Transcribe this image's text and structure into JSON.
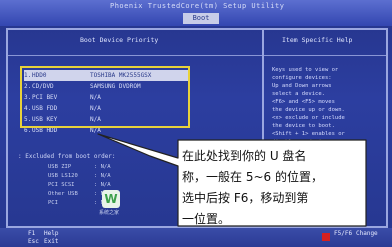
{
  "bios": {
    "title": "Phoenix TrustedCore(tm) Setup Utility",
    "active_tab": "Boot"
  },
  "left_panel": {
    "title": "Boot Device Priority",
    "boot_devices": [
      {
        "num": "1.",
        "device": "HDD0",
        "info": "TOSHIBA MK2555GSX",
        "selected": true
      },
      {
        "num": "2.",
        "device": "CD/DVD",
        "info": "SAMSUNG DVDROM",
        "selected": false
      },
      {
        "num": "3.",
        "device": "PCI BEV",
        "info": "N/A",
        "selected": false
      },
      {
        "num": "4.",
        "device": "USB FDD",
        "info": "N/A",
        "selected": false
      },
      {
        "num": "5.",
        "device": "USB KEY",
        "info": "N/A",
        "selected": false
      },
      {
        "num": "6.",
        "device": "USB HDD",
        "info": "N/A",
        "selected": false
      }
    ],
    "excluded_title": ":  Excluded from boot order:",
    "excluded_devices": [
      {
        "device": "USB ZIP",
        "info": ": N/A"
      },
      {
        "device": "USB LS120",
        "info": ": N/A"
      },
      {
        "device": "PCI SCSI",
        "info": ": N/A"
      },
      {
        "device": "Other USB",
        "info": ": N/A"
      },
      {
        "device": "PCI",
        "info": ": N/A"
      }
    ]
  },
  "right_panel": {
    "title": "Item Specific Help",
    "help_lines": [
      "Keys used to view or",
      "configure devices:",
      "Up and Down arrows",
      "select a device.",
      "<F6> and <F5> moves",
      "the device up or down.",
      "<x> exclude or include",
      "the device to boot.",
      "<Shift + 1> enables or",
      "disables a device."
    ]
  },
  "footer": {
    "f1_key": "F1",
    "f1_label": "Help",
    "esc_key": "Esc",
    "esc_label": "Exit",
    "f5f6_key": "F5/F6",
    "f5f6_label": "Change"
  },
  "watermark": {
    "logo_letter": "W",
    "caption": "系统之家"
  },
  "callout": {
    "line1": "在此处找到你的 U 盘名",
    "line2": "称，一般在 5~6 的位置，",
    "line3": "选中后按 F6，移动到第",
    "line4": "一位置。"
  },
  "colors": {
    "bios_blue": "#2a3a8a",
    "highlight_yellow": "#e8d23a",
    "callout_bg": "#ffffff"
  }
}
